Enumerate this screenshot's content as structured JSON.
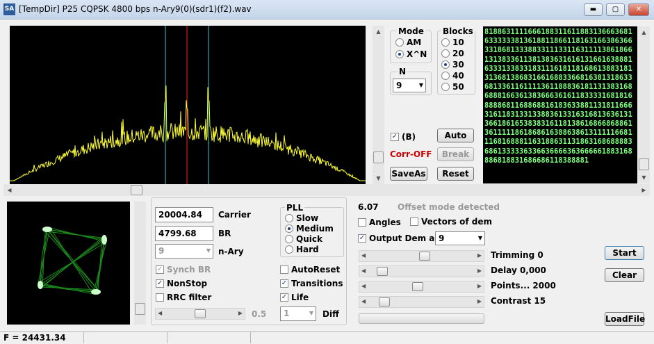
{
  "window": {
    "icon_text": "SA",
    "title": "[TempDir] P25 CQPSK 4800 bps n-Ary9(0)(sdr1)(f2).wav",
    "min": "▬",
    "max": "▢",
    "close": "✕"
  },
  "mode_group": {
    "title": "Mode",
    "options": [
      "AM",
      "X^N"
    ],
    "selected": "X^N"
  },
  "blocks_group": {
    "title": "Blocks",
    "options": [
      "10",
      "20",
      "30",
      "40",
      "50"
    ],
    "selected": "30"
  },
  "n_group": {
    "title": "N",
    "value": "9"
  },
  "b_check": {
    "label": "(B)",
    "checked": true
  },
  "corr_label": "Corr-OFF",
  "buttons": {
    "auto": "Auto",
    "break": "Break",
    "saveas": "SaveAs",
    "reset": "Reset",
    "start": "Start",
    "clear": "Clear",
    "loadfile": "LoadFile"
  },
  "digits": "81886311116661883116118831366636816333333813618811866118163166386366331868133388331113311631111386186613138336113813836316161316616388816333133833183111618118168613883181313681386831661688336681638131863368133611611113611888361811313831686888166361383666361611833331681816888868116886881618363388113181166631611831331338836133163168136361313661861653838316118138616866868861361111186186861638863861311111668111681688811631886311318631686888836861333336336636666363666661883168886818831686686118388881",
  "carrier": {
    "value": "20004.84",
    "label": "Carrier"
  },
  "br": {
    "value": "4799.68",
    "label": "BR"
  },
  "nary": {
    "value": "9",
    "label": "n-Ary"
  },
  "pll": {
    "title": "PLL",
    "options": [
      "Slow",
      "Medium",
      "Quick",
      "Hard"
    ],
    "selected": "Medium"
  },
  "left_checks": [
    {
      "label": "Synch BR",
      "checked": true,
      "disabled": true
    },
    {
      "label": "NonStop",
      "checked": true,
      "disabled": false
    },
    {
      "label": "RRC filter",
      "checked": false,
      "disabled": false
    }
  ],
  "mid_checks": [
    {
      "label": "AutoReset",
      "checked": false
    },
    {
      "label": "Transitions",
      "checked": true
    },
    {
      "label": "Life",
      "checked": true
    }
  ],
  "rrc_value": "0.5",
  "diff": {
    "value": "1",
    "label": "Diff"
  },
  "offset": {
    "value": "6.07",
    "message": "Offset mode detected"
  },
  "angles": {
    "label": "Angles",
    "checked": false
  },
  "vectors": {
    "label": "Vectors of dem",
    "checked": false
  },
  "output_dem": {
    "label": "Output Dem as",
    "checked": true,
    "value": "9"
  },
  "params": [
    {
      "label": "Trimming 0",
      "pos": 0.53
    },
    {
      "label": "Delay  0,000",
      "pos": 0.08
    },
    {
      "label": "Points... 2000",
      "pos": 0.46
    },
    {
      "label": "Contrast 15",
      "pos": 0.1
    }
  ],
  "status": {
    "freq": "F = 24431.34"
  },
  "colors": {
    "spectrum_trace": "#ffff33",
    "center_marker": "#ff2020",
    "side_marker": "#33cccc",
    "constellation": "#33ff33",
    "digits": "#7fff7f",
    "corr": "#cc0000"
  }
}
